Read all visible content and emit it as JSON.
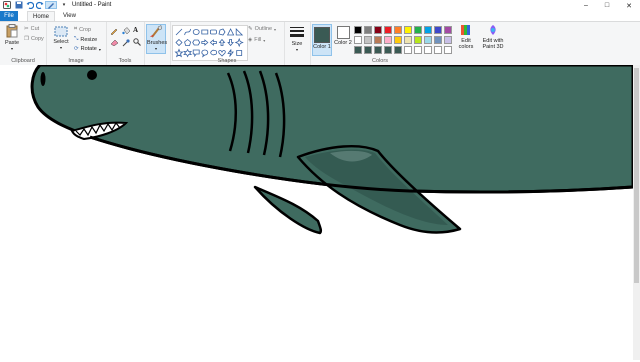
{
  "window": {
    "title": "Untitled - Paint",
    "controls": {
      "minimize": "–",
      "maximize": "□",
      "close": "✕"
    }
  },
  "quick_access": {
    "overflow": "▾"
  },
  "tabs": [
    {
      "label": "File",
      "active": false
    },
    {
      "label": "Home",
      "active": true
    },
    {
      "label": "View",
      "active": false
    }
  ],
  "clipboard": {
    "paste": "Paste",
    "cut": "Cut",
    "copy": "Copy",
    "group": "Clipboard"
  },
  "image": {
    "select": "Select",
    "crop": "Crop",
    "resize": "Resize",
    "rotate": "Rotate",
    "group": "Image"
  },
  "tools": {
    "group": "Tools"
  },
  "brushes": {
    "label": "Brushes"
  },
  "shapes": {
    "outline": "Outline",
    "fill": "Fill",
    "group": "Shapes"
  },
  "size": {
    "label": "Size"
  },
  "colors": {
    "color1": "Color 1",
    "color2": "Color 2",
    "color1_value": "#3a5a54",
    "color2_value": "#ffffff",
    "edit": "Edit colors",
    "paint3d": "Edit with Paint 3D",
    "group": "Colors",
    "palette_row1": [
      "#000000",
      "#7f7f7f",
      "#880015",
      "#ed1c24",
      "#ff7f27",
      "#fff200",
      "#22b14c",
      "#00a2e8",
      "#3f48cc",
      "#a349a4"
    ],
    "palette_row2": [
      "#ffffff",
      "#c3c3c3",
      "#b97a57",
      "#ffaec9",
      "#ffc90e",
      "#efe4b0",
      "#b5e61d",
      "#99d9ea",
      "#7092be",
      "#c8bfe7"
    ],
    "palette_row3": [
      "#3a5a54",
      "#3a5a54",
      "#3a5a54",
      "#3a5a54",
      "#3a5a54",
      "#ffffff",
      "#ffffff",
      "#ffffff",
      "#ffffff",
      "#ffffff"
    ]
  },
  "canvas": {
    "shark_body_color": "#3f6b60",
    "outline_color": "#000000"
  }
}
